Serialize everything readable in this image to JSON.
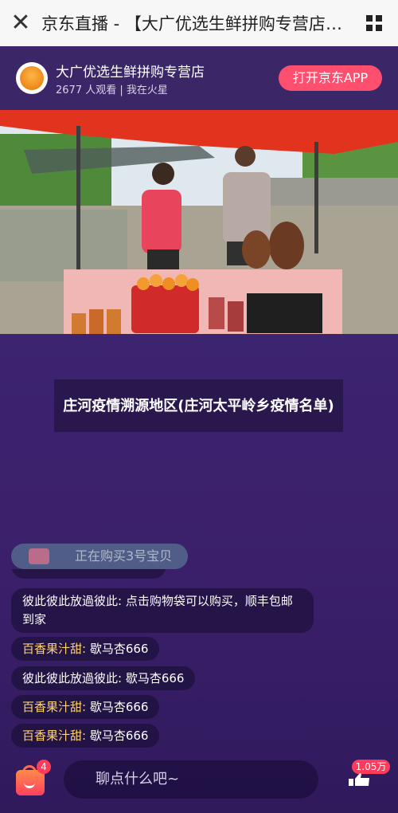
{
  "browser": {
    "title": "京东直播 - 【大广优选生鲜拼购专营店】..."
  },
  "store": {
    "name": "大广优选生鲜拼购专营店",
    "viewers": "2677 人观看",
    "location": "我在火星",
    "open_app_label": "打开京东APP"
  },
  "caption": "庄河疫情溯源地区(庄河太平岭乡疫情名单)",
  "buying_tag": "正在购买3号宝贝",
  "comments": [
    {
      "user": "彼此彼此放過彼此:",
      "text": "点击购物袋可以购买，顺丰包邮到家",
      "user_color": "white"
    },
    {
      "user": "百香果汁甜:",
      "text": "歇马杏666",
      "user_color": "yellow"
    },
    {
      "user": "彼此彼此放過彼此:",
      "text": "歇马杏666",
      "user_color": "white"
    },
    {
      "user": "百香果汁甜:",
      "text": "歇马杏666",
      "user_color": "yellow"
    },
    {
      "user": "百香果汁甜:",
      "text": "歇马杏666",
      "user_color": "yellow"
    }
  ],
  "bottom": {
    "cart_count": "4",
    "input_placeholder": "聊点什么吧~",
    "likes": "1.05万"
  },
  "colors": {
    "accent": "#ff4f6f",
    "background": "#3b2468",
    "username_yellow": "#ffd36a"
  },
  "icons": [
    "close-icon",
    "grid-menu-icon",
    "shopping-bag-icon",
    "like-icon"
  ]
}
